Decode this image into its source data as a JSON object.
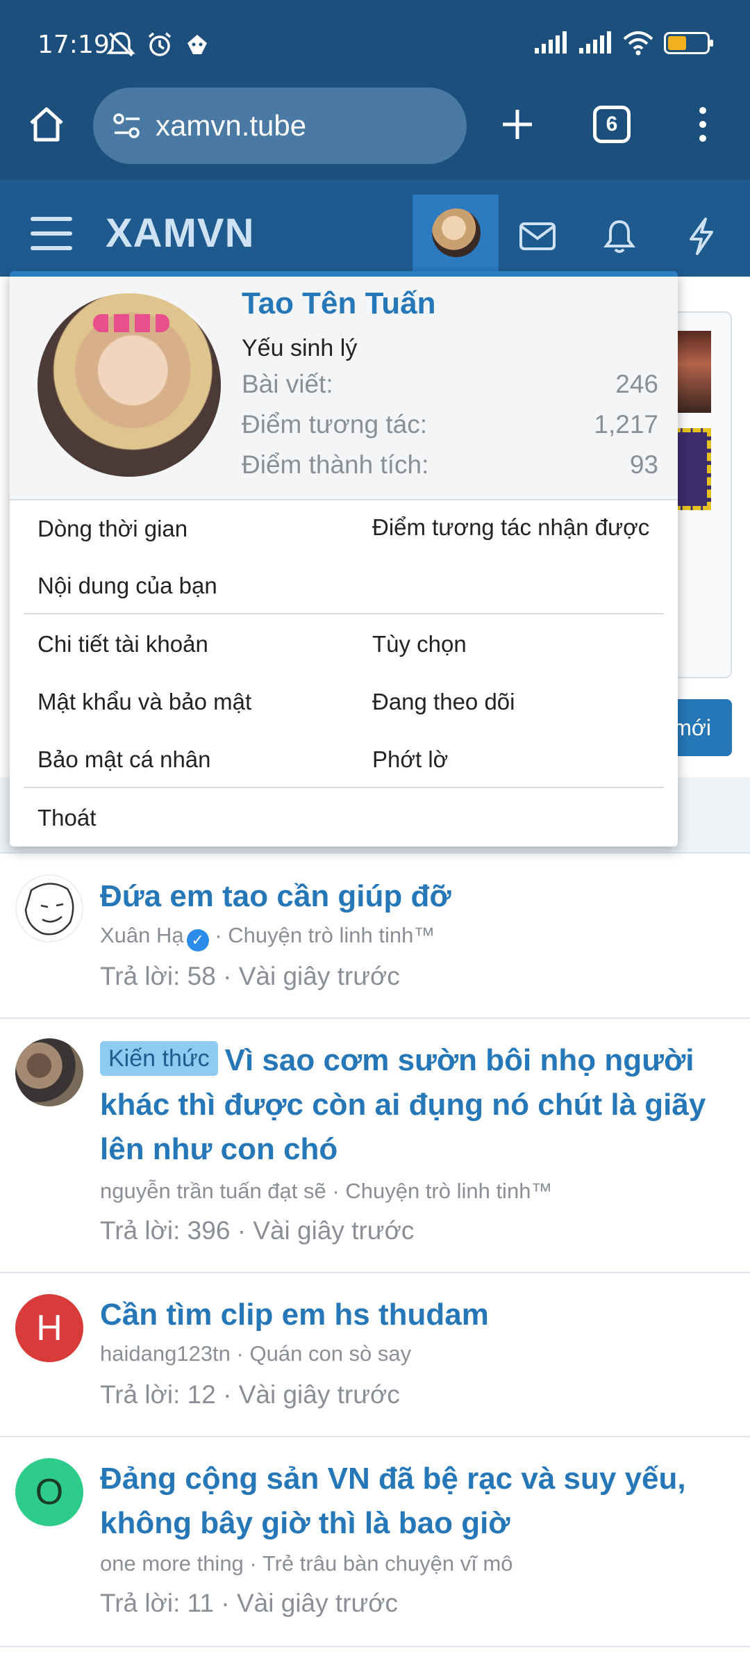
{
  "status_bar": {
    "time": "17:19"
  },
  "browser": {
    "url": "xamvn.tube",
    "tab_count": "6"
  },
  "site": {
    "logo": "XAMVN"
  },
  "account_menu": {
    "username": "Tao Tên Tuấn",
    "user_title": "Yếu sinh lý",
    "stats": [
      {
        "label": "Bài viết:",
        "value": "246"
      },
      {
        "label": "Điểm tương tác:",
        "value": "1,217"
      },
      {
        "label": "Điểm thành tích:",
        "value": "93"
      }
    ],
    "links": {
      "timeline": "Dòng thời gian",
      "reactions_received": "Điểm tương tác nhận được",
      "your_content": "Nội dung của bạn",
      "account_details": "Chi tiết tài khoản",
      "preferences": "Tùy chọn",
      "password_security": "Mật khẩu và bảo mật",
      "following": "Đang theo dõi",
      "privacy": "Bảo mật cá nhân",
      "ignoring": "Phớt lờ",
      "logout": "Thoát"
    }
  },
  "background": {
    "new_button_partial": "mới"
  },
  "threads": [
    {
      "title": "Đứa em tao cần giúp đỡ",
      "author": "Xuân Hạ",
      "forum": "Chuyện trò linh tinh™",
      "replies": "Trả lời: 58",
      "time": "Vài giây trước",
      "avatar_letter": ""
    },
    {
      "prefix": "Kiến thức",
      "title": "Vì sao cơm sườn bôi nhọ người khác thì được còn ai đụng nó chút là giãy lên như con chó",
      "author": "nguyễn trần tuấn đạt sẽ",
      "forum": "Chuyện trò linh tinh™",
      "replies": "Trả lời: 396",
      "time": "Vài giây trước",
      "avatar_letter": ""
    },
    {
      "title": "Cần tìm clip em hs thudam",
      "author": "haidang123tn",
      "forum": "Quán con sò say",
      "replies": "Trả lời: 12",
      "time": "Vài giây trước",
      "avatar_letter": "H",
      "avatar_color": "#d93a3a"
    },
    {
      "title": "Đảng cộng sản VN đã bệ rạc và suy yếu, không bây giờ thì là bao giờ",
      "author": "one more thing",
      "forum": "Trẻ trâu bàn chuyện vĩ mô",
      "replies": "Trả lời: 11",
      "time": "Vài giây trước",
      "avatar_letter": "O",
      "avatar_color": "#2ecc8b"
    }
  ],
  "separators": {
    "dot": "·"
  }
}
